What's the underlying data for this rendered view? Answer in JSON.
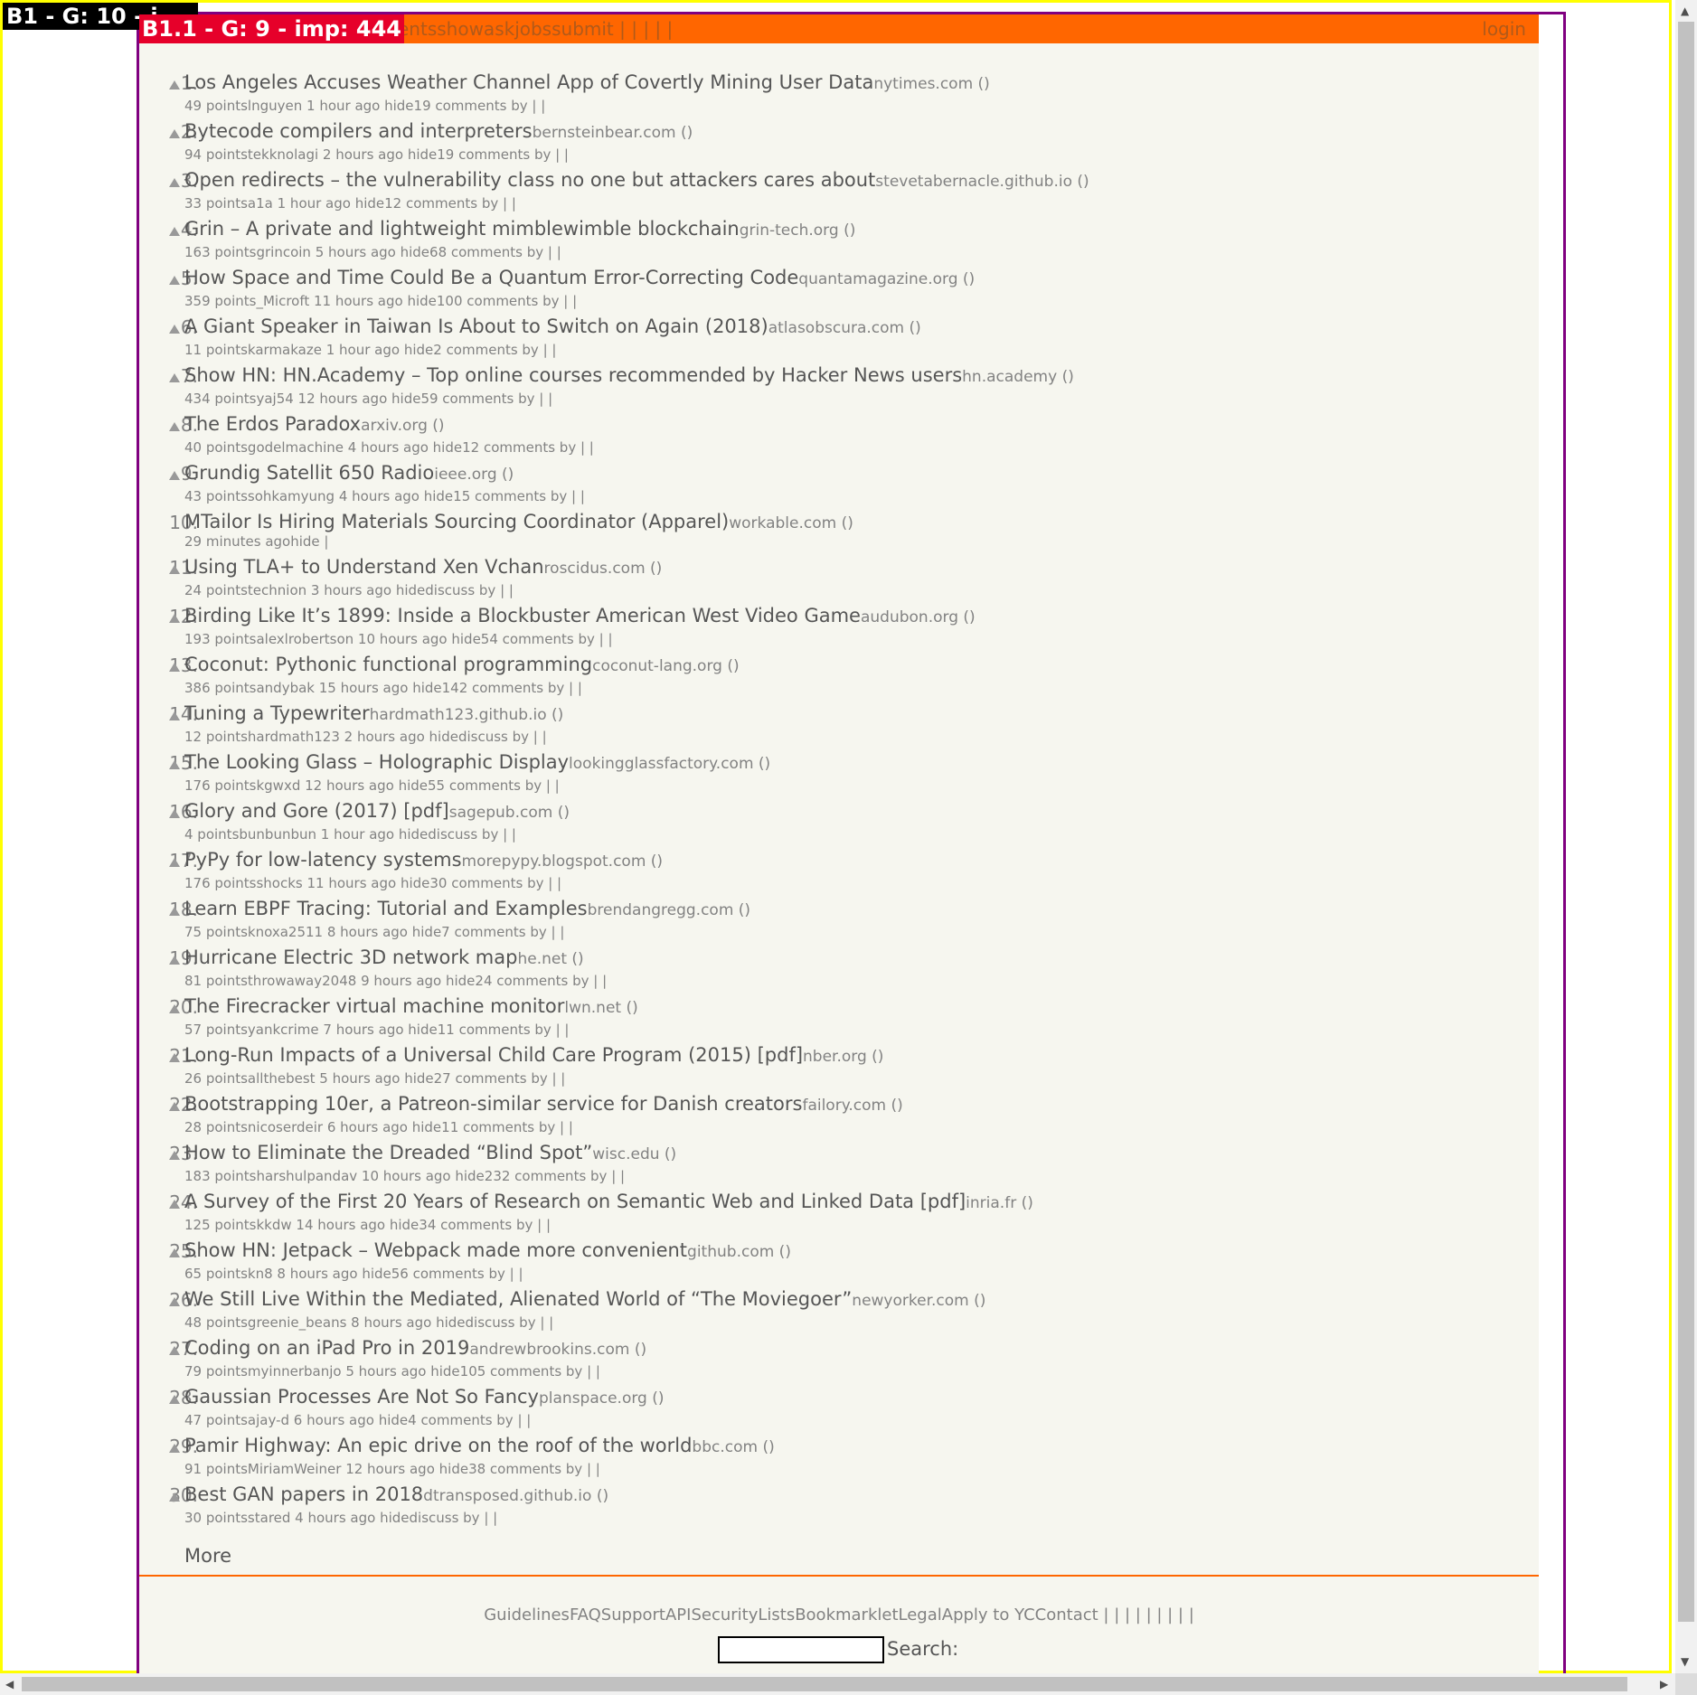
{
  "overlay": {
    "outer_label": "B1 - G: 10 - i",
    "inner_label": "B1.1 - G: 9 - imp: 444"
  },
  "header": {
    "nav_text": "entsshowaskjobssubmit | | | | |",
    "login": "login"
  },
  "items": [
    {
      "rank": "1.",
      "title": "Los Angeles Accuses Weather Channel App of Covertly Mining User Data",
      "site": "nytimes.com ()",
      "sub": "49 pointslnguyen 1 hour ago hide19 comments by | |"
    },
    {
      "rank": "2.",
      "title": "Bytecode compilers and interpreters",
      "site": "bernsteinbear.com ()",
      "sub": "94 pointstekknolagi 2 hours ago hide19 comments by | |"
    },
    {
      "rank": "3.",
      "title": "Open redirects – the vulnerability class no one but attackers cares about",
      "site": "stevetabernacle.github.io ()",
      "sub": "33 pointsa1a 1 hour ago hide12 comments by | |"
    },
    {
      "rank": "4.",
      "title": "Grin – A private and lightweight mimblewimble blockchain",
      "site": "grin-tech.org ()",
      "sub": "163 pointsgrincoin 5 hours ago hide68 comments by | |"
    },
    {
      "rank": "5.",
      "title": "How Space and Time Could Be a Quantum Error-Correcting Code",
      "site": "quantamagazine.org ()",
      "sub": "359 points_Microft 11 hours ago hide100 comments by | |"
    },
    {
      "rank": "6.",
      "title": "A Giant Speaker in Taiwan Is About to Switch on Again (2018)",
      "site": "atlasobscura.com ()",
      "sub": "11 pointskarmakaze 1 hour ago hide2 comments by | |"
    },
    {
      "rank": "7.",
      "title": "Show HN: HN.Academy – Top online courses recommended by Hacker News users",
      "site": "hn.academy ()",
      "sub": "434 pointsyaj54 12 hours ago hide59 comments by | |"
    },
    {
      "rank": "8.",
      "title": "The Erdos Paradox",
      "site": "arxiv.org ()",
      "sub": "40 pointsgodelmachine 4 hours ago hide12 comments by | |"
    },
    {
      "rank": "9.",
      "title": "Grundig Satellit 650 Radio",
      "site": "ieee.org ()",
      "sub": "43 pointssohkamyung 4 hours ago hide15 comments by | |"
    },
    {
      "rank": "10.",
      "title": "MTailor Is Hiring Materials Sourcing Coordinator (Apparel)",
      "site": "workable.com ()",
      "sub": "29 minutes agohide |",
      "job": true
    },
    {
      "rank": "11.",
      "title": "Using TLA+ to Understand Xen Vchan",
      "site": "roscidus.com ()",
      "sub": "24 pointstechnion 3 hours ago hidediscuss by | |"
    },
    {
      "rank": "12.",
      "title": "Birding Like It’s 1899: Inside a Blockbuster American West Video Game",
      "site": "audubon.org ()",
      "sub": "193 pointsalexlrobertson 10 hours ago hide54 comments by | |"
    },
    {
      "rank": "13.",
      "title": "Coconut: Pythonic functional programming",
      "site": "coconut-lang.org ()",
      "sub": "386 pointsandybak 15 hours ago hide142 comments by | |"
    },
    {
      "rank": "14.",
      "title": "Tuning a Typewriter",
      "site": "hardmath123.github.io ()",
      "sub": "12 pointshardmath123 2 hours ago hidediscuss by | |"
    },
    {
      "rank": "15.",
      "title": "The Looking Glass – Holographic Display",
      "site": "lookingglassfactory.com ()",
      "sub": "176 pointskgwxd 12 hours ago hide55 comments by | |"
    },
    {
      "rank": "16.",
      "title": "Glory and Gore (2017) [pdf]",
      "site": "sagepub.com ()",
      "sub": "4 pointsbunbunbun 1 hour ago hidediscuss by | |"
    },
    {
      "rank": "17.",
      "title": "PyPy for low-latency systems",
      "site": "morepypy.blogspot.com ()",
      "sub": "176 pointsshocks 11 hours ago hide30 comments by | |"
    },
    {
      "rank": "18.",
      "title": "Learn EBPF Tracing: Tutorial and Examples",
      "site": "brendangregg.com ()",
      "sub": "75 pointsknoxa2511 8 hours ago hide7 comments by | |"
    },
    {
      "rank": "19.",
      "title": "Hurricane Electric 3D network map",
      "site": "he.net ()",
      "sub": "81 pointsthrowaway2048 9 hours ago hide24 comments by | |"
    },
    {
      "rank": "20.",
      "title": "The Firecracker virtual machine monitor",
      "site": "lwn.net ()",
      "sub": "57 pointsyankcrime 7 hours ago hide11 comments by | |"
    },
    {
      "rank": "21.",
      "title": "Long-Run Impacts of a Universal Child Care Program (2015) [pdf]",
      "site": "nber.org ()",
      "sub": "26 pointsallthebest 5 hours ago hide27 comments by | |"
    },
    {
      "rank": "22.",
      "title": "Bootstrapping 10er, a Patreon-similar service for Danish creators",
      "site": "failory.com ()",
      "sub": "28 pointsnicoserdeir 6 hours ago hide11 comments by | |"
    },
    {
      "rank": "23.",
      "title": "How to Eliminate the Dreaded “Blind Spot”",
      "site": "wisc.edu ()",
      "sub": "183 pointsharshulpandav 10 hours ago hide232 comments by | |"
    },
    {
      "rank": "24.",
      "title": "A Survey of the First 20 Years of Research on Semantic Web and Linked Data [pdf]",
      "site": "inria.fr ()",
      "sub": "125 pointskkdw 14 hours ago hide34 comments by | |"
    },
    {
      "rank": "25.",
      "title": "Show HN: Jetpack – Webpack made more convenient",
      "site": "github.com ()",
      "sub": "65 pointskn8 8 hours ago hide56 comments by | |"
    },
    {
      "rank": "26.",
      "title": "We Still Live Within the Mediated, Alienated World of “The Moviegoer”",
      "site": "newyorker.com ()",
      "sub": "48 pointsgreenie_beans 8 hours ago hidediscuss by | |"
    },
    {
      "rank": "27.",
      "title": "Coding on an iPad Pro in 2019",
      "site": "andrewbrookins.com ()",
      "sub": "79 pointsmyinnerbanjo 5 hours ago hide105 comments by | |"
    },
    {
      "rank": "28.",
      "title": "Gaussian Processes Are Not So Fancy",
      "site": "planspace.org ()",
      "sub": "47 pointsajay-d 6 hours ago hide4 comments by | |"
    },
    {
      "rank": "29.",
      "title": "Pamir Highway: An epic drive on the roof of the world",
      "site": "bbc.com ()",
      "sub": "91 pointsMiriamWeiner 12 hours ago hide38 comments by | |"
    },
    {
      "rank": "30.",
      "title": "Best GAN papers in 2018",
      "site": "dtransposed.github.io ()",
      "sub": "30 pointsstared 4 hours ago hidediscuss by | |"
    }
  ],
  "more": "More",
  "footer": {
    "links": "GuidelinesFAQSupportAPISecurityListsBookmarkletLegalApply to YCContact | | | | | | | | |",
    "search_label": "Search:"
  },
  "colors": {
    "accent": "#ff6600",
    "page_bg": "#f6f6ef",
    "overlay_red": "#e6002a",
    "frame_purple": "#800080",
    "frame_yellow": "#ffff00"
  }
}
